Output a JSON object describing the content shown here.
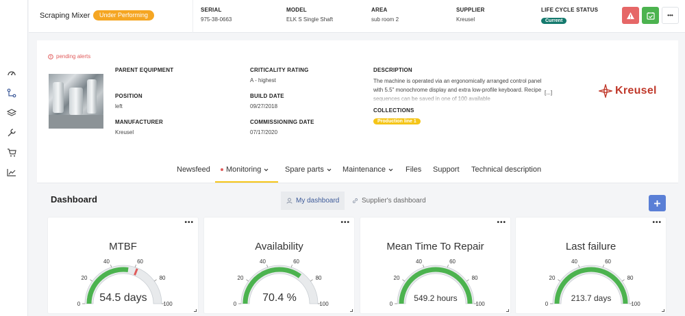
{
  "sidebar": {
    "items": [
      {
        "icon": "gauge-icon"
      },
      {
        "icon": "workflow-icon"
      },
      {
        "icon": "layers-icon"
      },
      {
        "icon": "wrench-icon"
      },
      {
        "icon": "cart-icon"
      },
      {
        "icon": "trend-icon"
      }
    ]
  },
  "header": {
    "asset_name": "Scraping Mixer",
    "status": "Under Performing",
    "fields": {
      "serial": {
        "label": "SERIAL",
        "value": "975-38-0663"
      },
      "model": {
        "label": "MODEL",
        "value": "ELK S Single Shaft"
      },
      "area": {
        "label": "AREA",
        "value": "sub room 2"
      },
      "supplier": {
        "label": "SUPPLIER",
        "value": "Kreusel"
      },
      "lifecycle": {
        "label": "LIFE CYCLE STATUS",
        "value": "Current"
      }
    },
    "actions": {
      "alert_color": "#e66767",
      "calendar_color": "#4cb34f",
      "more": "•••"
    }
  },
  "details": {
    "pending_alerts": "pending alerts",
    "parent_equipment": {
      "label": "PARENT EQUIPMENT",
      "value": ""
    },
    "position": {
      "label": "POSITION",
      "value": "left"
    },
    "manufacturer": {
      "label": "MANUFACTURER",
      "value": "Kreusel"
    },
    "criticality": {
      "label": "CRITICALITY RATING",
      "value": "A - highest"
    },
    "build_date": {
      "label": "BUILD DATE",
      "value": "09/27/2018"
    },
    "commissioning_date": {
      "label": "COMMISSIONING DATE",
      "value": "07/17/2020"
    },
    "description": {
      "label": "DESCRIPTION",
      "value": "The machine is operated via an ergonomically arranged control panel with 5.5\" monochrome display and extra low-profile keyboard. Recipe sequences can be saved in one of 100 available",
      "more": "[...]"
    },
    "collections": {
      "label": "COLLECTIONS",
      "tag": "Production line 1"
    },
    "logo_text": "Kreusel"
  },
  "tabs": [
    {
      "label": "Newsfeed",
      "dropdown": false
    },
    {
      "label": "Monitoring",
      "dropdown": true,
      "active": true
    },
    {
      "label": "Spare parts",
      "dropdown": true
    },
    {
      "label": "Maintenance",
      "dropdown": true
    },
    {
      "label": "Files",
      "dropdown": false
    },
    {
      "label": "Support",
      "dropdown": false
    },
    {
      "label": "Technical description",
      "dropdown": false
    }
  ],
  "dashboard": {
    "title": "Dashboard",
    "my_dashboard": "My dashboard",
    "supplier_dashboard": "Supplier's dashboard",
    "add_label": "+"
  },
  "gauges": [
    {
      "title": "MTBF",
      "value_text": "54.5 days",
      "value": 54.5,
      "marker": 62,
      "ticks": [
        "0",
        "20",
        "40",
        "60",
        "80",
        "100"
      ]
    },
    {
      "title": "Availability",
      "value_text": "70.4 %",
      "value": 70.4,
      "ticks": [
        "0",
        "20",
        "40",
        "60",
        "80",
        "100"
      ]
    },
    {
      "title": "Mean Time To Repair",
      "value_text": "549.2 hours",
      "value": 100,
      "ticks": [
        "0",
        "20",
        "40",
        "60",
        "80",
        "100"
      ]
    },
    {
      "title": "Last failure",
      "value_text": "213.7 days",
      "value": 100,
      "ticks": [
        "0",
        "20",
        "40",
        "60",
        "80",
        "100"
      ]
    }
  ],
  "colors": {
    "gauge_fill": "#4cb34f",
    "gauge_track": "#e8eaec",
    "marker": "#e05b5b",
    "accent": "#f5c518"
  }
}
